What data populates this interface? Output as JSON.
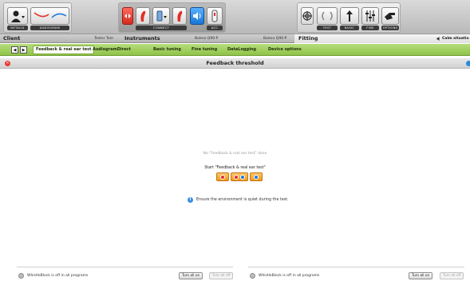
{
  "toolbar": {
    "details_label": "DETAILS",
    "audiogram_label": "AUDIOGRAM",
    "connect_label": "CONNECT",
    "acc_label": "ACC",
    "test_label": "TEST",
    "basic_label": "BASIC",
    "fine_label": "FINE",
    "options_label": "OPTIONS"
  },
  "sections": {
    "client": "Client",
    "client_name": "Tester Tom",
    "instruments": "Instruments",
    "left_device": "Bolero Q90-P",
    "right_device": "Bolero Q90-P",
    "fitting": "Fitting",
    "situation": "Calm situatio"
  },
  "tabs": [
    {
      "label": "Feedback & real ear test"
    },
    {
      "label": "AudiogramDirect"
    },
    {
      "label": "Basic tuning"
    },
    {
      "label": "Fine tuning"
    },
    {
      "label": "DataLogging"
    },
    {
      "label": "Device options"
    }
  ],
  "panel": {
    "title": "Feedback threshold",
    "status": "No \"Feedback & real ear test\" done",
    "start_label": "Start \"Feedback & real ear test\"",
    "info": "Ensure the environment is quiet during the test."
  },
  "bottom": {
    "left": {
      "whistleblock": "WhistleBlock is off in all programs",
      "turn_all_on": "Turn all on",
      "turn_all_off": "Turn all off"
    },
    "right": {
      "whistleblock": "WhistleBlock is off in all programs",
      "turn_all_on": "Turn all on",
      "turn_all_off": "Turn all off"
    }
  },
  "colors": {
    "tab_green": "#9fcf5a",
    "start_orange": "#f5a623",
    "close_red": "#e6392f",
    "info_blue": "#3b8de0"
  }
}
